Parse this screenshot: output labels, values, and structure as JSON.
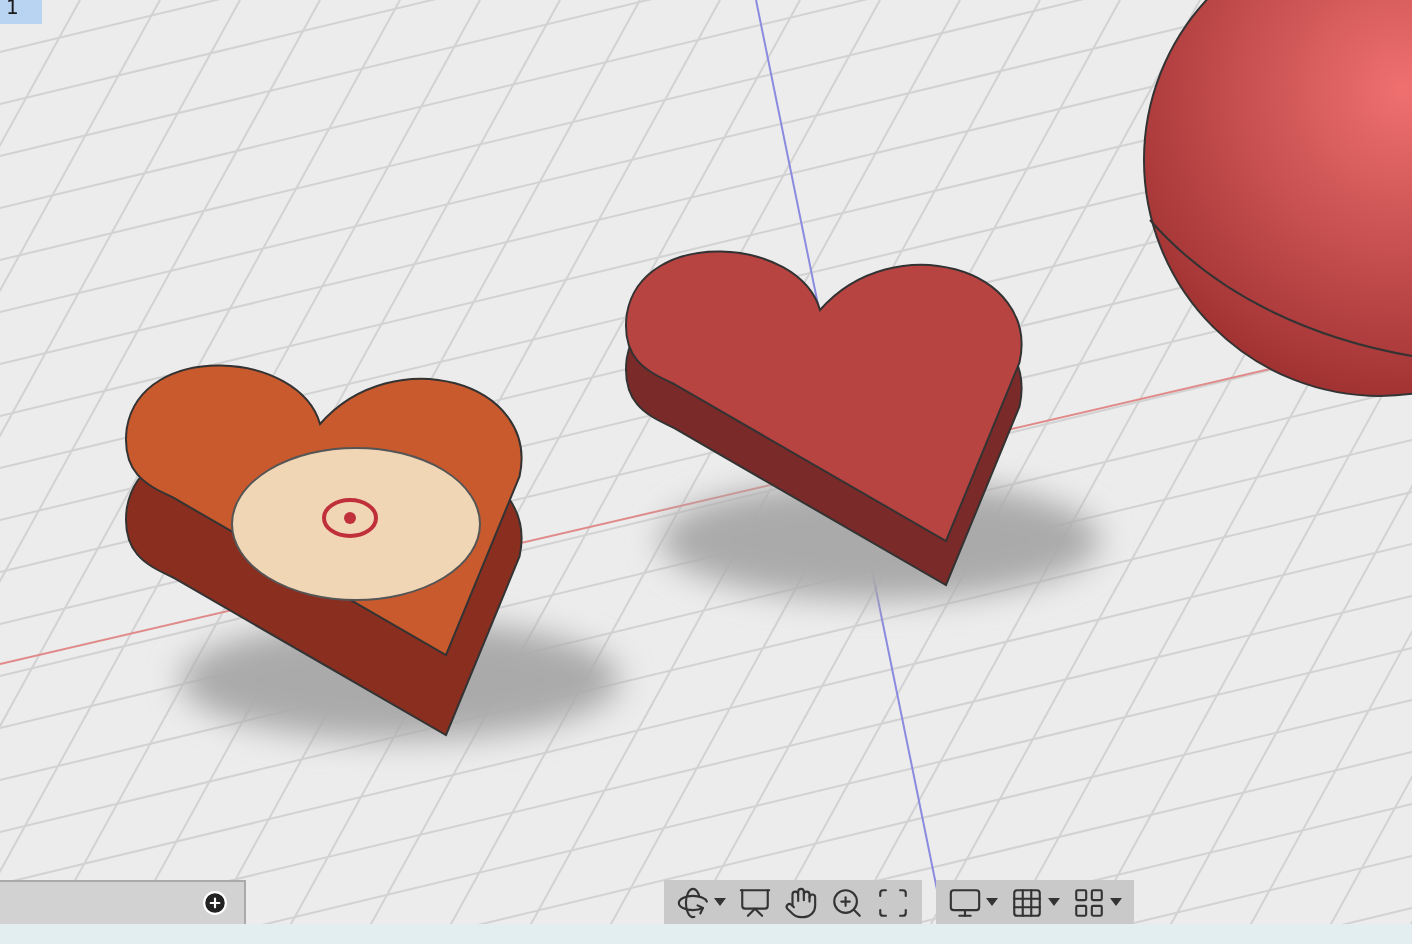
{
  "viewport": {
    "label": "1"
  },
  "toolbars": [
    {
      "tools": [
        {
          "kind": "orbit",
          "dropdown": true
        },
        {
          "kind": "look-at",
          "dropdown": false
        },
        {
          "kind": "pan",
          "dropdown": false
        },
        {
          "kind": "zoom",
          "dropdown": false
        },
        {
          "kind": "fit",
          "dropdown": false
        }
      ]
    },
    {
      "tools": [
        {
          "kind": "display",
          "dropdown": true
        },
        {
          "kind": "grid",
          "dropdown": true
        },
        {
          "kind": "viewports",
          "dropdown": true
        }
      ]
    }
  ]
}
